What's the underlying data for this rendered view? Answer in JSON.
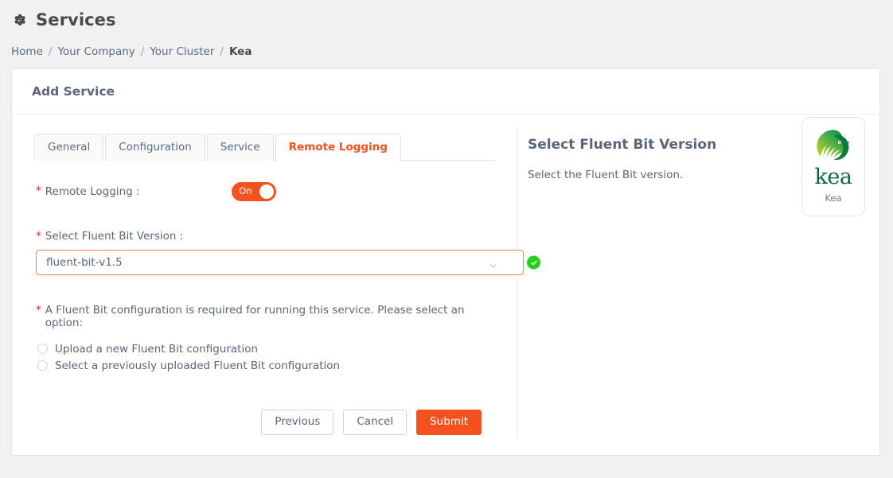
{
  "header": {
    "icon": "cogs-icon",
    "title": "Services"
  },
  "breadcrumb": {
    "separator": "/",
    "items": [
      {
        "label": "Home",
        "active": false
      },
      {
        "label": "Your Company",
        "active": false
      },
      {
        "label": "Your Cluster",
        "active": false
      },
      {
        "label": "Kea",
        "active": true
      }
    ]
  },
  "card": {
    "title": "Add Service"
  },
  "tabs": [
    {
      "label": "General",
      "active": false
    },
    {
      "label": "Configuration",
      "active": false
    },
    {
      "label": "Service",
      "active": false
    },
    {
      "label": "Remote Logging",
      "active": true
    }
  ],
  "form": {
    "required_mark": "*",
    "colon": ":",
    "remote_logging": {
      "label": "Remote Logging",
      "toggle_state": "On"
    },
    "fluent_bit_version": {
      "label": "Select Fluent Bit Version",
      "value": "fluent-bit-v1.5",
      "chevron_icon": "chevron-down-icon",
      "validation_icon": "check-circle-icon"
    },
    "config_option": {
      "instruction": "A Fluent Bit configuration is required for running this service. Please select an option:",
      "options": [
        {
          "label": "Upload a new Fluent Bit configuration",
          "selected": false
        },
        {
          "label": "Select a previously uploaded Fluent Bit configuration",
          "selected": false
        }
      ]
    },
    "buttons": {
      "previous": "Previous",
      "cancel": "Cancel",
      "submit": "Submit"
    }
  },
  "help_panel": {
    "title": "Select Fluent Bit Version",
    "description": "Select the Fluent Bit version.",
    "logo": {
      "icon": "kea-bird-logo-icon",
      "wordmark": "kea",
      "caption": "Kea"
    }
  },
  "colors": {
    "accent_orange": "#f4511e",
    "required_pink": "#e5175f",
    "valid_green": "#1fd214",
    "text_slate": "#5a6678",
    "kea_green": "#0b6b3a",
    "page_bg": "#f1f1f1"
  }
}
